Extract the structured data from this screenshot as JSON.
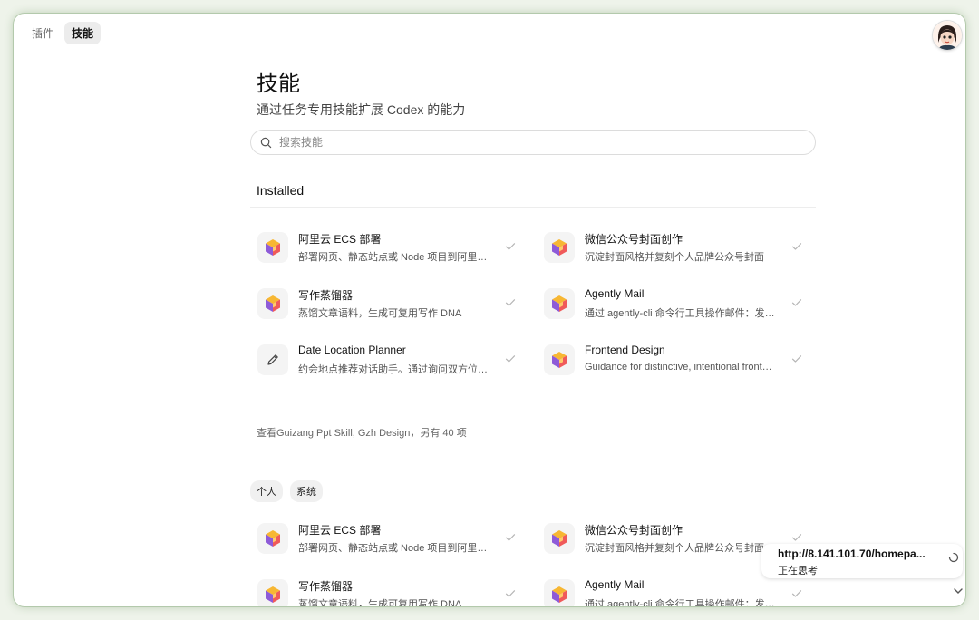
{
  "tabs": [
    {
      "label": "插件",
      "active": false
    },
    {
      "label": "技能",
      "active": true
    }
  ],
  "page": {
    "title": "技能",
    "subtitle": "通过任务专用技能扩展 Codex 的能力"
  },
  "search": {
    "placeholder": "搜索技能",
    "value": ""
  },
  "installed": {
    "title": "Installed",
    "items": [
      {
        "name": "阿里云 ECS 部署",
        "desc": "部署网页、静态站点或 Node 项目到阿里云 ECS",
        "icon": "cube-icon",
        "installed": true
      },
      {
        "name": "微信公众号封面创作",
        "desc": "沉淀封面风格并复刻个人品牌公众号封面",
        "icon": "cube-icon",
        "installed": true
      },
      {
        "name": "写作蒸馏器",
        "desc": "蒸馏文章语料，生成可复用写作 DNA",
        "icon": "cube-icon",
        "installed": true
      },
      {
        "name": "Agently Mail",
        "desc": "通过 agently-cli 命令行工具操作邮件：发送邮件",
        "icon": "cube-icon",
        "installed": true
      },
      {
        "name": "Date Location Planner",
        "desc": "约会地点推荐对话助手。通过询问双方位置和偏好",
        "icon": "pencil-icon",
        "installed": true
      },
      {
        "name": "Frontend Design",
        "desc": "Guidance for distinctive, intentional frontend design",
        "icon": "cube-icon",
        "installed": true
      }
    ],
    "more_text": "查看Guizang Ppt Skill, Gzh Design，另有 40 项"
  },
  "filters": [
    "个人",
    "系统"
  ],
  "personal": {
    "items": [
      {
        "name": "阿里云 ECS 部署",
        "desc": "部署网页、静态站点或 Node 项目到阿里云 ECS",
        "icon": "cube-icon",
        "installed": true
      },
      {
        "name": "微信公众号封面创作",
        "desc": "沉淀封面风格并复刻个人品牌公众号封面",
        "icon": "cube-icon",
        "installed": true
      },
      {
        "name": "写作蒸馏器",
        "desc": "蒸馏文章语料，生成可复用写作 DNA",
        "icon": "cube-icon",
        "installed": true
      },
      {
        "name": "Agently Mail",
        "desc": "通过 agently-cli 命令行工具操作邮件：发送邮件",
        "icon": "cube-icon",
        "installed": true
      }
    ]
  },
  "toast": {
    "url": "http://8.141.101.70/homepa...",
    "status": "正在思考"
  },
  "colors": {
    "accent_orange": "#f5a623",
    "accent_purple": "#8e5bd8",
    "check": "#b5b5b5"
  }
}
